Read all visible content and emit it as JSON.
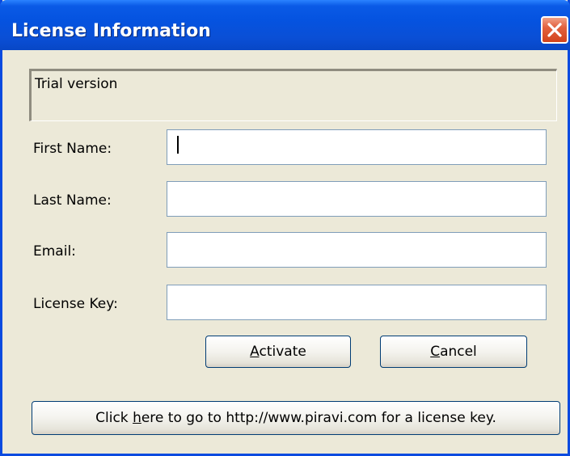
{
  "window": {
    "title": "License Information"
  },
  "status": {
    "text": "Trial version"
  },
  "form": {
    "first_name_label": "First Name:",
    "last_name_label": "Last Name:",
    "email_label": "Email:",
    "license_key_label": "License Key:",
    "first_name_value": "",
    "last_name_value": "",
    "email_value": "",
    "license_key_value": ""
  },
  "buttons": {
    "activate": {
      "accel": "A",
      "rest": "ctivate"
    },
    "cancel": {
      "accel": "C",
      "rest": "ancel"
    },
    "license_link": {
      "before": "Click ",
      "accel": "h",
      "after": "ere to go to http://www.piravi.com for a license key."
    }
  },
  "icons": {
    "close": "close-icon"
  },
  "colors": {
    "titlebar": "#0553e0",
    "close_button": "#d3431b",
    "background": "#ece9d8"
  }
}
